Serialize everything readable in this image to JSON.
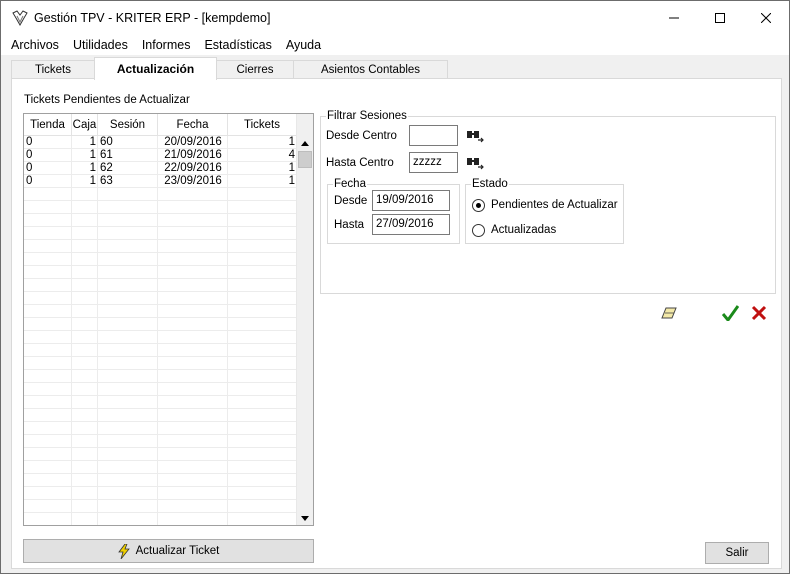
{
  "window": {
    "title": "Gestión TPV - KRITER ERP - [kempdemo]"
  },
  "menu": [
    "Archivos",
    "Utilidades",
    "Informes",
    "Estadísticas",
    "Ayuda"
  ],
  "tabs": [
    {
      "label": "Tickets",
      "active": false
    },
    {
      "label": "Actualización",
      "active": true
    },
    {
      "label": "Cierres",
      "active": false
    },
    {
      "label": "Asientos Contables",
      "active": false
    }
  ],
  "grid": {
    "caption": "Tickets Pendientes de Actualizar",
    "columns": [
      "Tienda",
      "Caja",
      "Sesión",
      "Fecha",
      "Tickets"
    ],
    "rows": [
      [
        "0",
        "1",
        "60",
        "20/09/2016",
        "1"
      ],
      [
        "0",
        "1",
        "61",
        "21/09/2016",
        "4"
      ],
      [
        "0",
        "1",
        "62",
        "22/09/2016",
        "1"
      ],
      [
        "0",
        "1",
        "63",
        "23/09/2016",
        "1"
      ]
    ]
  },
  "filter": {
    "legend": "Filtrar Sesiones",
    "desde_centro_label": "Desde Centro",
    "desde_centro_value": "",
    "hasta_centro_label": "Hasta Centro",
    "hasta_centro_value": "zzzzz",
    "fecha": {
      "legend": "Fecha",
      "desde_label": "Desde",
      "desde_value": "19/09/2016",
      "hasta_label": "Hasta",
      "hasta_value": "27/09/2016"
    },
    "estado": {
      "legend": "Estado",
      "options": [
        {
          "label": "Pendientes de Actualizar",
          "selected": true
        },
        {
          "label": "Actualizadas",
          "selected": false
        }
      ]
    }
  },
  "buttons": {
    "actualizar": "Actualizar Ticket",
    "salir": "Salir"
  },
  "colors": {
    "accept": "#1a8a1a",
    "cancel": "#c01010",
    "bolt": "#e8c000"
  }
}
